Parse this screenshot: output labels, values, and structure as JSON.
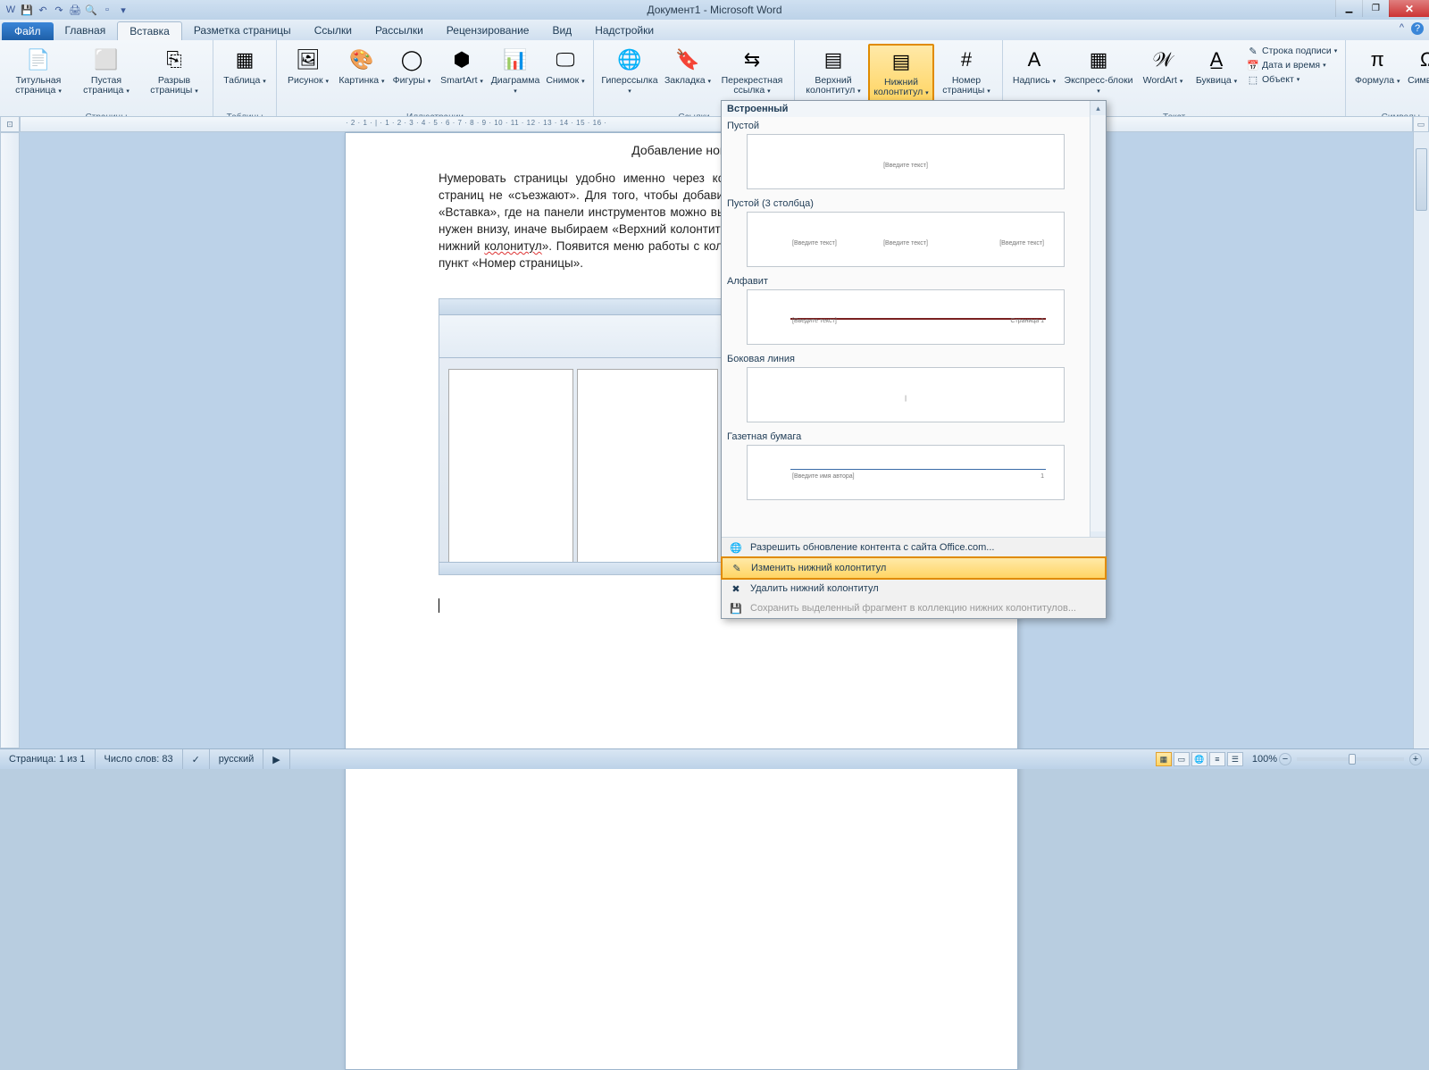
{
  "app": {
    "title": "Документ1 - Microsoft Word"
  },
  "tabs": {
    "file": "Файл",
    "items": [
      "Главная",
      "Вставка",
      "Разметка страницы",
      "Ссылки",
      "Рассылки",
      "Рецензирование",
      "Вид",
      "Надстройки"
    ],
    "active_index": 1
  },
  "ribbon": {
    "groups": [
      {
        "label": "Страницы",
        "big": [
          {
            "name": "cover-page",
            "label": "Титульная\nстраница",
            "icon": "📄"
          },
          {
            "name": "blank-page",
            "label": "Пустая\nстраница",
            "icon": "⬜"
          },
          {
            "name": "page-break",
            "label": "Разрыв\nстраницы",
            "icon": "⎘"
          }
        ]
      },
      {
        "label": "Таблицы",
        "big": [
          {
            "name": "table",
            "label": "Таблица",
            "icon": "▦"
          }
        ]
      },
      {
        "label": "Иллюстрации",
        "big": [
          {
            "name": "picture",
            "label": "Рисунок",
            "icon": "🖼"
          },
          {
            "name": "clipart",
            "label": "Картинка",
            "icon": "🎨"
          },
          {
            "name": "shapes",
            "label": "Фигуры",
            "icon": "◯"
          },
          {
            "name": "smartart",
            "label": "SmartArt",
            "icon": "⬢"
          },
          {
            "name": "chart",
            "label": "Диаграмма",
            "icon": "📊"
          },
          {
            "name": "screenshot",
            "label": "Снимок",
            "icon": "🖵"
          }
        ]
      },
      {
        "label": "Ссылки",
        "big": [
          {
            "name": "hyperlink",
            "label": "Гиперссылка",
            "icon": "🌐"
          },
          {
            "name": "bookmark",
            "label": "Закладка",
            "icon": "🔖"
          },
          {
            "name": "crossref",
            "label": "Перекрестная\nссылка",
            "icon": "⇆"
          }
        ]
      },
      {
        "label": "Колонтитулы",
        "big": [
          {
            "name": "header",
            "label": "Верхний\nколонтитул",
            "icon": "▤"
          },
          {
            "name": "footer",
            "label": "Нижний\nколонтитул",
            "icon": "▤",
            "highlighted": true
          },
          {
            "name": "page-number",
            "label": "Номер\nстраницы",
            "icon": "#"
          }
        ]
      },
      {
        "label": "Текст",
        "big": [
          {
            "name": "textbox",
            "label": "Надпись",
            "icon": "A"
          },
          {
            "name": "quickparts",
            "label": "Экспресс-блоки",
            "icon": "▦"
          },
          {
            "name": "wordart",
            "label": "WordArt",
            "icon": "𝒲"
          },
          {
            "name": "dropcap",
            "label": "Буквица",
            "icon": "A̲"
          }
        ],
        "small": [
          {
            "name": "signature-line",
            "label": "Строка подписи",
            "icon": "✎"
          },
          {
            "name": "datetime",
            "label": "Дата и время",
            "icon": "📅"
          },
          {
            "name": "object",
            "label": "Объект",
            "icon": "⬚"
          }
        ]
      },
      {
        "label": "Символы",
        "big": [
          {
            "name": "equation",
            "label": "Формула",
            "icon": "π"
          },
          {
            "name": "symbol",
            "label": "Символ",
            "icon": "Ω"
          }
        ]
      }
    ]
  },
  "document": {
    "title_text": "Добавление номеров страниц",
    "para": "Нумеровать страницы удобно именно через колонтитулы, поскольку в этом случае, номера страниц не «съезжают». Для того, чтобы добавить колонтитул, необходимо перейти во вкладку «Вставка», где на панели инструментов можно выбрать пункт «Нижний колонтитул» (если он нам нужен внизу, иначе выбираем «Верхний колонтитул»), в появившемся меню выбираем «Изменить нижний ",
    "para_underlined_word": "колонитул",
    "para_after": "». Появится меню работы с колонтитулами, где, на панели инструментов, будет пункт «Номер страницы»."
  },
  "gallery": {
    "section": "Встроенный",
    "items": [
      {
        "label": "Пустой",
        "placeholder_center": "[Введите текст]"
      },
      {
        "label": "Пустой (3 столбца)",
        "placeholder_left": "[Введите текст]",
        "placeholder_center": "[Введите текст]",
        "placeholder_right": "[Введите текст]"
      },
      {
        "label": "Алфавит",
        "placeholder_left": "[Введите текст]",
        "placeholder_right": "Страница 1",
        "hr": true
      },
      {
        "label": "Боковая линия",
        "placeholder_center": "|"
      },
      {
        "label": "Газетная бумага",
        "placeholder_left": "[Введите имя автора]",
        "placeholder_right": "1",
        "topline": true
      }
    ],
    "menu": [
      {
        "name": "office-com",
        "label": "Разрешить обновление контента с сайта Office.com...",
        "icon": "🌐"
      },
      {
        "name": "edit-footer",
        "label": "Изменить нижний колонтитул",
        "icon": "✎",
        "highlighted": true
      },
      {
        "name": "delete-footer",
        "label": "Удалить нижний колонтитул",
        "icon": "✖"
      },
      {
        "name": "save-selection",
        "label": "Сохранить выделенный фрагмент в коллекцию нижних колонтитулов...",
        "icon": "💾",
        "disabled": true
      }
    ]
  },
  "ruler": {
    "h_marks": "· 2 · 1 · | · 1 · 2 · 3 · 4 · 5 · 6 · 7 · 8 · 9 · 10 · 11 · 12 · 13 · 14 · 15 · 16 ·"
  },
  "status": {
    "page": "Страница: 1 из 1",
    "words": "Число слов: 83",
    "lang": "русский",
    "zoom": "100%"
  }
}
